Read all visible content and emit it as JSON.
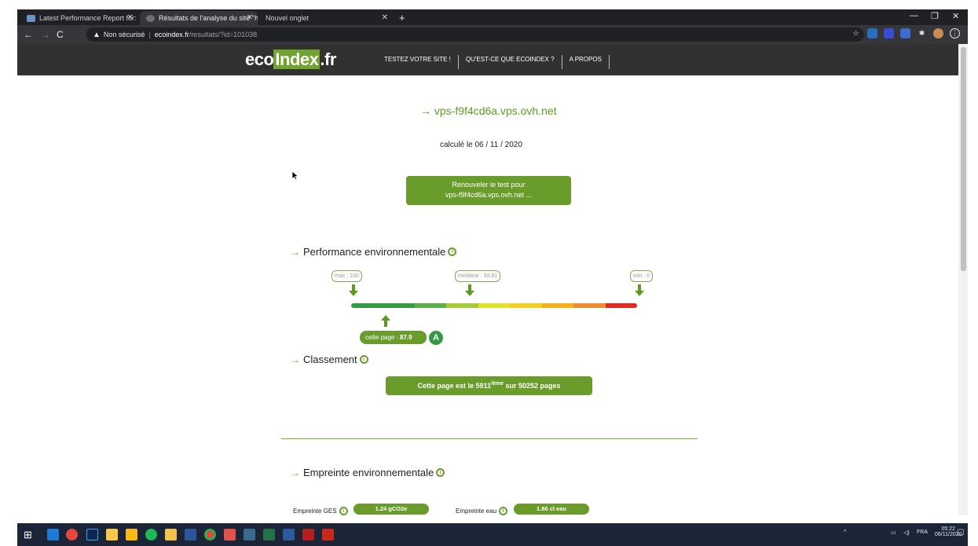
{
  "browser": {
    "tabs": [
      {
        "label": "Latest Performance Report for: h"
      },
      {
        "label": "Résultats de l'analyse du site \"htt"
      },
      {
        "label": "Nouvel onglet"
      }
    ],
    "new_tab": "+",
    "address": {
      "security": "Non sécurisé",
      "host": "ecoindex.fr",
      "path": "/resultats/?id=101038"
    }
  },
  "site": {
    "logo_left": "eco",
    "logo_mid": "Index",
    "logo_right": ".fr",
    "menu": [
      "TESTEZ VOTRE SITE !",
      "QU'EST-CE QUE ECOINDEX ?",
      "A PROPOS"
    ]
  },
  "result": {
    "site_name": "→ vps-f9f4cd6a.vps.ovh.net",
    "date_label": "calculé le 06 / 11 / 2020",
    "renew_line1": "Renouveler le test pour",
    "renew_line2": "vps-f9f4cd6a.vps.ovh.net ..."
  },
  "performance": {
    "title": "Performance environnementale",
    "max_label": "max : 100",
    "median_label": "médiane : 58.81",
    "min_label": "min : 0",
    "score_prefix": "cette page : ",
    "score": "87.9",
    "grade": "A",
    "scale_colors": [
      "#349a45",
      "#349a45",
      "#5cb04a",
      "#a6cc3e",
      "#e2e22a",
      "#f4cf22",
      "#f5b11c",
      "#ef8c32",
      "#e02b20"
    ]
  },
  "ranking": {
    "title": "Classement",
    "prefix": "Cette page est le ",
    "rank": "5911",
    "suffix_sup": "ième",
    "suffix": " sur 50252 pages"
  },
  "footprint": {
    "title": "Empreinte environnementale",
    "ges_label": "Empreinte GES",
    "ges_value": "1.24 gCO2e",
    "water_label": "Empreinte eau",
    "water_value": "1.86 cl eau"
  },
  "taskbar": {
    "time": "05:22",
    "date": "06/11/2020",
    "lang": "FRA"
  }
}
